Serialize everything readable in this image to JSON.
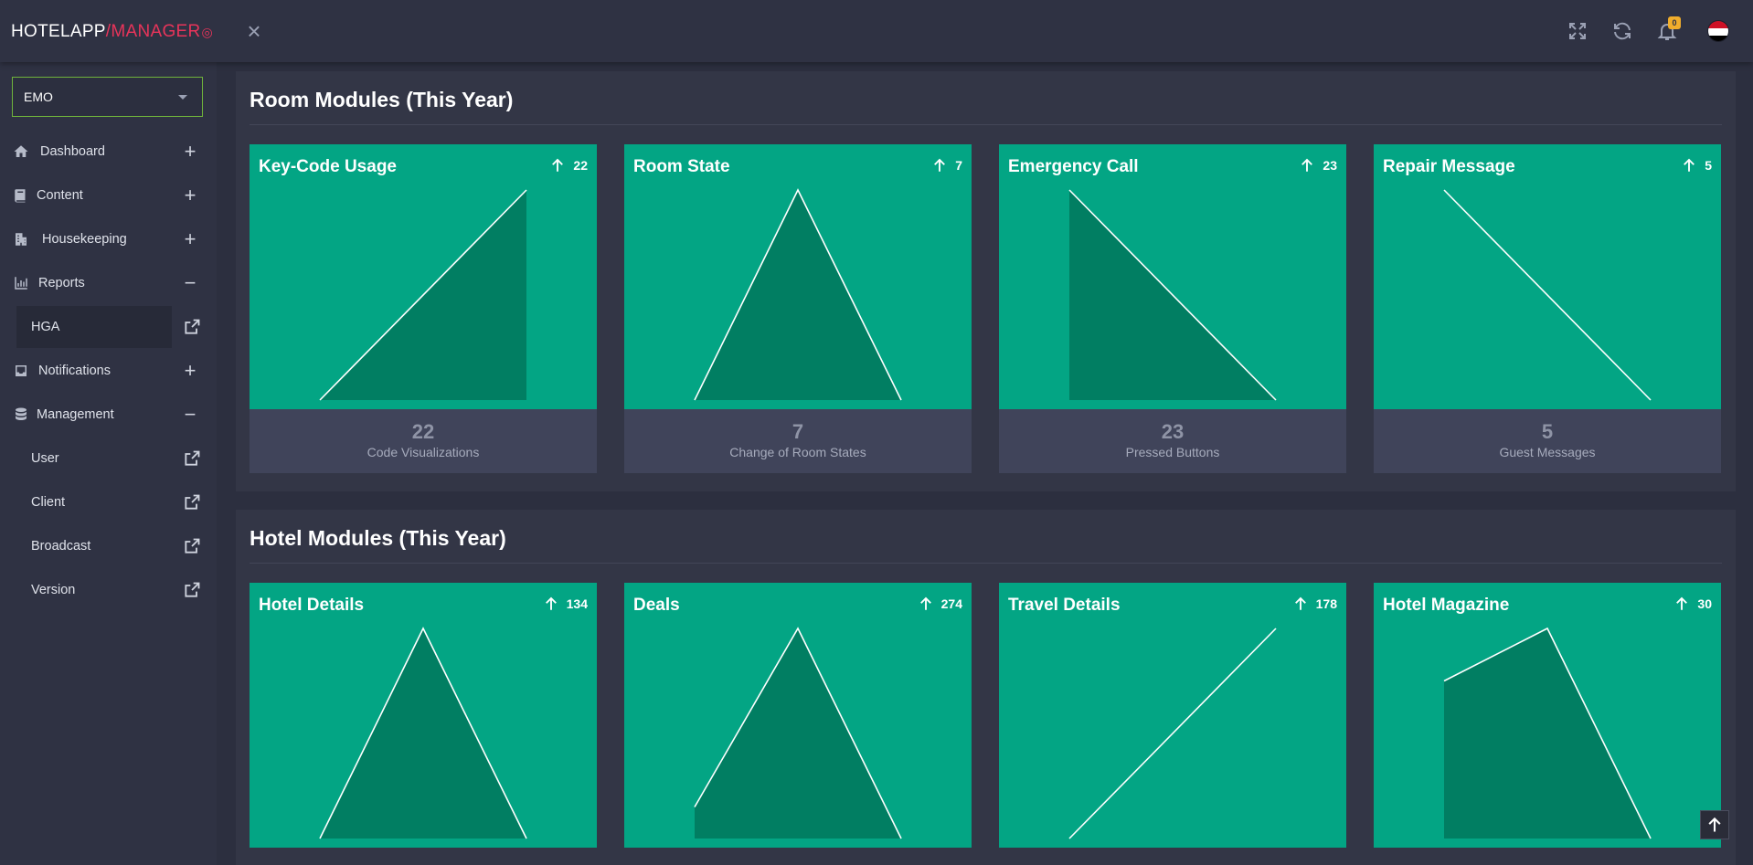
{
  "brand": {
    "part1": "HOTELAPP",
    "part2": "/MANAGER"
  },
  "topbar": {
    "notification_count": "0"
  },
  "sidebar": {
    "hotel_select": "EMO",
    "items": [
      {
        "label": "Dashboard",
        "icon": "home-icon",
        "state": "+"
      },
      {
        "label": "Content",
        "icon": "book-icon",
        "state": "+"
      },
      {
        "label": "Housekeeping",
        "icon": "building-icon",
        "state": "+"
      },
      {
        "label": "Reports",
        "icon": "bar-chart-icon",
        "state": "−"
      },
      {
        "label": "Notifications",
        "icon": "inbox-icon",
        "state": "+"
      },
      {
        "label": "Management",
        "icon": "database-icon",
        "state": "−"
      }
    ],
    "reports_sub": [
      {
        "label": "HGA"
      }
    ],
    "management_sub": [
      {
        "label": "User"
      },
      {
        "label": "Client"
      },
      {
        "label": "Broadcast"
      },
      {
        "label": "Version"
      }
    ]
  },
  "room_panel": {
    "title": "Room Modules (This Year)",
    "cards": [
      {
        "title": "Key-Code Usage",
        "delta": "22",
        "value": "22",
        "caption": "Code Visualizations",
        "trend": [
          0,
          22
        ]
      },
      {
        "title": "Room State",
        "delta": "7",
        "value": "7",
        "caption": "Change of Room States",
        "trend": [
          0,
          7,
          0
        ]
      },
      {
        "title": "Emergency Call",
        "delta": "23",
        "value": "23",
        "caption": "Pressed Buttons",
        "trend": [
          23,
          0
        ]
      },
      {
        "title": "Repair Message",
        "delta": "5",
        "value": "5",
        "caption": "Guest Messages",
        "trend": [
          5,
          0
        ]
      }
    ]
  },
  "hotel_panel": {
    "title": "Hotel Modules (This Year)",
    "cards": [
      {
        "title": "Hotel Details",
        "delta": "134",
        "trend": [
          0,
          134,
          0
        ]
      },
      {
        "title": "Deals",
        "delta": "274",
        "trend": [
          0.15,
          1,
          0
        ]
      },
      {
        "title": "Travel Details",
        "delta": "178",
        "trend": [
          0,
          1
        ]
      },
      {
        "title": "Hotel Magazine",
        "delta": "30",
        "trend": [
          0.75,
          1,
          0
        ]
      }
    ]
  },
  "colors": {
    "card": "#03a584",
    "area": "#017e62",
    "accent": "#e8345a",
    "select_border": "#6fb33c"
  }
}
